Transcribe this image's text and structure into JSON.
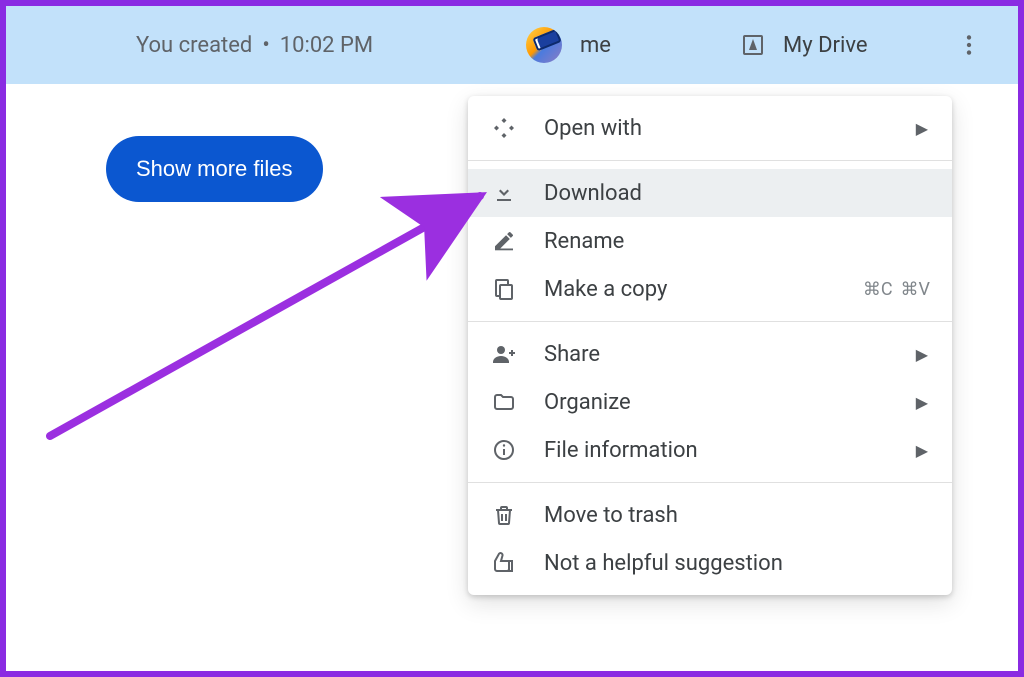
{
  "header": {
    "created_label": "You created",
    "separator": "•",
    "time": "10:02 PM",
    "owner": "me",
    "location": "My Drive"
  },
  "actions": {
    "show_more": "Show more files"
  },
  "menu": {
    "groups": [
      {
        "items": [
          {
            "id": "open-with",
            "label": "Open with",
            "icon": "open-with-icon",
            "submenu": true
          }
        ]
      },
      {
        "items": [
          {
            "id": "download",
            "label": "Download",
            "icon": "download-icon",
            "highlight": true
          },
          {
            "id": "rename",
            "label": "Rename",
            "icon": "rename-icon"
          },
          {
            "id": "make-a-copy",
            "label": "Make a copy",
            "icon": "copy-icon",
            "shortcut": [
              "⌘C",
              "⌘V"
            ]
          }
        ]
      },
      {
        "items": [
          {
            "id": "share",
            "label": "Share",
            "icon": "share-icon",
            "submenu": true
          },
          {
            "id": "organize",
            "label": "Organize",
            "icon": "organize-icon",
            "submenu": true
          },
          {
            "id": "file-info",
            "label": "File information",
            "icon": "info-icon",
            "submenu": true
          }
        ]
      },
      {
        "items": [
          {
            "id": "trash",
            "label": "Move to trash",
            "icon": "trash-icon"
          },
          {
            "id": "not-helpful",
            "label": "Not a helpful suggestion",
            "icon": "thumbs-down-icon"
          }
        ]
      }
    ]
  },
  "colors": {
    "selection_row": "#c2e1fa",
    "primary": "#0b57d0",
    "annotation": "#8a2be2"
  }
}
